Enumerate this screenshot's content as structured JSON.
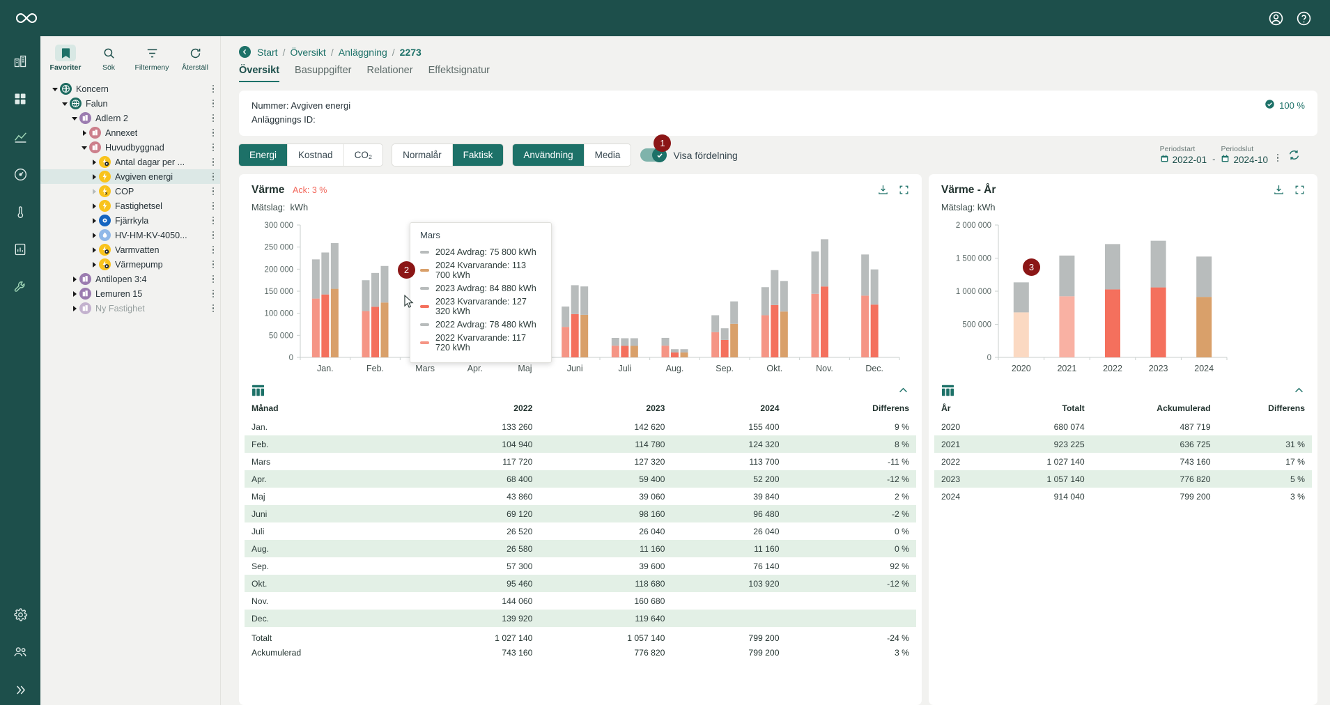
{
  "topbar": {
    "account_icon": "account-circle-icon",
    "help_icon": "help-circle-icon",
    "logo": "infinity-logo"
  },
  "rail": [
    {
      "name": "rail-item-buildings",
      "icon": "buildings-icon"
    },
    {
      "name": "rail-item-dashboard",
      "icon": "dashboard-grid-icon"
    },
    {
      "name": "rail-item-chart",
      "icon": "area-chart-icon"
    },
    {
      "name": "rail-item-gauge",
      "icon": "gauge-icon"
    },
    {
      "name": "rail-item-temperature",
      "icon": "thermometer-icon"
    },
    {
      "name": "rail-item-report",
      "icon": "report-icon"
    },
    {
      "name": "rail-item-tools",
      "icon": "wrench-icon"
    },
    {
      "name": "rail-item-settings",
      "icon": "gear-icon"
    },
    {
      "name": "rail-item-users",
      "icon": "people-icon"
    },
    {
      "name": "rail-item-expand",
      "icon": "chevron-double-right-icon"
    }
  ],
  "sidebar": {
    "tools": [
      {
        "label": "Favoriter",
        "icon": "bookmark-icon",
        "active": true
      },
      {
        "label": "Sök",
        "icon": "search-icon",
        "active": false
      },
      {
        "label": "Filtermeny",
        "icon": "filter-icon",
        "active": false
      },
      {
        "label": "Återställ",
        "icon": "refresh-icon",
        "active": false
      }
    ],
    "tree": [
      {
        "label": "Koncern",
        "depth": 0,
        "caret": "down",
        "icon": "globe-icon",
        "color": "#1d6b60",
        "selected": false,
        "muted": false
      },
      {
        "label": "Falun",
        "depth": 1,
        "caret": "down",
        "icon": "globe-icon",
        "color": "#1d6b60",
        "selected": false,
        "muted": false
      },
      {
        "label": "Adlern 2",
        "depth": 2,
        "caret": "down",
        "icon": "building-icon",
        "color": "#9b7cb0",
        "selected": false,
        "muted": false
      },
      {
        "label": "Annexet",
        "depth": 3,
        "caret": "right",
        "icon": "building-icon",
        "color": "#cc7f8b",
        "selected": false,
        "muted": false
      },
      {
        "label": "Huvudbyggnad",
        "depth": 3,
        "caret": "down",
        "icon": "building-icon",
        "color": "#cc7f8b",
        "selected": false,
        "muted": false
      },
      {
        "label": "Antal dagar per ...",
        "depth": 4,
        "caret": "right",
        "icon": "meter-icon",
        "color": "#f9c31c",
        "selected": false,
        "muted": false
      },
      {
        "label": "Avgiven energi",
        "depth": 4,
        "caret": "right",
        "icon": "bolt-icon",
        "color": "#f9c31c",
        "selected": true,
        "muted": false
      },
      {
        "label": "COP",
        "depth": 4,
        "caret": "right-muted",
        "icon": "formula-icon",
        "color": "#f9c31c",
        "selected": false,
        "muted": false
      },
      {
        "label": "Fastighetsel",
        "depth": 4,
        "caret": "right",
        "icon": "bolt-icon",
        "color": "#f9c31c",
        "selected": false,
        "muted": false
      },
      {
        "label": "Fjärrkyla",
        "depth": 4,
        "caret": "right",
        "icon": "snow-icon",
        "color": "#1565c0",
        "selected": false,
        "muted": false
      },
      {
        "label": "HV-HM-KV-4050...",
        "depth": 4,
        "caret": "right",
        "icon": "droplet-icon",
        "color": "#90b8e8",
        "selected": false,
        "muted": false
      },
      {
        "label": "Varmvatten",
        "depth": 4,
        "caret": "right",
        "icon": "meter-icon",
        "color": "#f9c31c",
        "selected": false,
        "muted": false
      },
      {
        "label": "Värmepump",
        "depth": 4,
        "caret": "right",
        "icon": "meter-icon",
        "color": "#f9c31c",
        "selected": false,
        "muted": false
      },
      {
        "label": "Antilopen 3:4",
        "depth": 2,
        "caret": "right",
        "icon": "building-icon",
        "color": "#9b7cb0",
        "selected": false,
        "muted": false
      },
      {
        "label": "Lemuren 15",
        "depth": 2,
        "caret": "right",
        "icon": "building-icon",
        "color": "#9b7cb0",
        "selected": false,
        "muted": false
      },
      {
        "label": "Ny Fastighet",
        "depth": 2,
        "caret": "right",
        "icon": "building-icon",
        "color": "#c3b2ce",
        "selected": false,
        "muted": true
      }
    ]
  },
  "breadcrumb": {
    "back_icon": "back-arrow-icon",
    "items": [
      "Start",
      "Översikt",
      "Anläggning"
    ],
    "current": "2273",
    "separator": "/"
  },
  "tabs": [
    {
      "label": "Översikt",
      "active": true
    },
    {
      "label": "Basuppgifter",
      "active": false
    },
    {
      "label": "Relationer",
      "active": false
    },
    {
      "label": "Effektsignatur",
      "active": false
    }
  ],
  "info": {
    "line1": "Nummer: Avgiven energi",
    "line2": "Anläggnings ID:",
    "percent": "100 %",
    "percent_icon": "check-circle-icon"
  },
  "controls": {
    "group1": [
      {
        "label": "Energi",
        "active": true
      },
      {
        "label": "Kostnad",
        "active": false
      },
      {
        "label": "CO₂",
        "active": false
      }
    ],
    "group2": [
      {
        "label": "Normalår",
        "active": false
      },
      {
        "label": "Faktisk",
        "active": true
      }
    ],
    "group3": [
      {
        "label": "Användning",
        "active": true
      },
      {
        "label": "Media",
        "active": false
      }
    ],
    "toggle": {
      "label": "Visa fördelning",
      "on": true,
      "badge": "1"
    },
    "period": {
      "start_label": "Periodstart",
      "end_label": "Periodslut",
      "start_value": "2022-01",
      "end_value": "2024-10",
      "dash": "-",
      "calendar_icon": "calendar-icon",
      "more_icon": "more-vertical-icon",
      "refresh_icon": "refresh-circular-icon"
    }
  },
  "left_panel": {
    "title": "Värme",
    "ack": "Ack: 3 %",
    "subtitle_label": "Mätslag:",
    "subtitle_value": "kWh",
    "download_icon": "download-icon",
    "expand_icon": "fullscreen-icon",
    "grid_icon": "table-grid-icon",
    "collapse_icon": "chevron-up-icon",
    "badge": "2",
    "tooltip": {
      "title": "Mars",
      "rows": [
        {
          "text": "2024 Avdrag: 75 800 kWh",
          "color": "#b8bcbc"
        },
        {
          "text": "2024 Kvarvarande: 113 700 kWh",
          "color": "#d9a06a"
        },
        {
          "text": "2023 Avdrag: 84 880 kWh",
          "color": "#b8bcbc"
        },
        {
          "text": "2023 Kvarvarande: 127 320 kWh",
          "color": "#f4705d"
        },
        {
          "text": "2022 Avdrag: 78 480 kWh",
          "color": "#b8bcbc"
        },
        {
          "text": "2022 Kvarvarande: 117 720 kWh",
          "color": "#f59585"
        }
      ]
    },
    "table": {
      "columns": [
        "Månad",
        "2022",
        "2023",
        "2024",
        "Differens"
      ],
      "rows": [
        [
          "Jan.",
          "133 260",
          "142 620",
          "155 400",
          "9 %"
        ],
        [
          "Feb.",
          "104 940",
          "114 780",
          "124 320",
          "8 %"
        ],
        [
          "Mars",
          "117 720",
          "127 320",
          "113 700",
          "-11 %"
        ],
        [
          "Apr.",
          "68 400",
          "59 400",
          "52 200",
          "-12 %"
        ],
        [
          "Maj",
          "43 860",
          "39 060",
          "39 840",
          "2 %"
        ],
        [
          "Juni",
          "69 120",
          "98 160",
          "96 480",
          "-2 %"
        ],
        [
          "Juli",
          "26 520",
          "26 040",
          "26 040",
          "0 %"
        ],
        [
          "Aug.",
          "26 580",
          "11 160",
          "11 160",
          "0 %"
        ],
        [
          "Sep.",
          "57 300",
          "39 600",
          "76 140",
          "92 %"
        ],
        [
          "Okt.",
          "95 460",
          "118 680",
          "103 920",
          "-12 %"
        ],
        [
          "Nov.",
          "144 060",
          "160 680",
          "",
          ""
        ],
        [
          "Dec.",
          "139 920",
          "119 640",
          "",
          ""
        ]
      ],
      "footer": [
        [
          "Totalt",
          "1 027 140",
          "1 057 140",
          "799 200",
          "-24 %"
        ],
        [
          "Ackumulerad",
          "743 160",
          "776 820",
          "799 200",
          "3 %"
        ]
      ]
    }
  },
  "right_panel": {
    "title": "Värme - År",
    "subtitle": "Mätslag: kWh",
    "download_icon": "download-icon",
    "expand_icon": "fullscreen-icon",
    "grid_icon": "table-grid-icon",
    "collapse_icon": "chevron-up-icon",
    "badge": "3",
    "table": {
      "columns": [
        "År",
        "Totalt",
        "Ackumulerad",
        "Differens"
      ],
      "rows": [
        [
          "2020",
          "680 074",
          "487 719",
          ""
        ],
        [
          "2021",
          "923 225",
          "636 725",
          "31 %"
        ],
        [
          "2022",
          "1 027 140",
          "743 160",
          "17 %"
        ],
        [
          "2023",
          "1 057 140",
          "776 820",
          "5 %"
        ],
        [
          "2024",
          "914 040",
          "799 200",
          "3 %"
        ]
      ]
    }
  },
  "colors": {
    "brand_dark": "#1d4f4b",
    "brand": "#1d7168",
    "accent_red": "#f2665a",
    "badge": "#8b1616",
    "grey_series": "#b8bcbc",
    "row_alt": "#e3f0e6"
  },
  "chart_data": [
    {
      "type": "bar",
      "stacked": true,
      "grouped": true,
      "title": "Värme",
      "subtitle": "Mätslag: kWh",
      "xlabel": "",
      "ylabel": "kWh",
      "ylim": [
        0,
        300000
      ],
      "yticks": [
        0,
        50000,
        100000,
        150000,
        200000,
        250000,
        300000
      ],
      "ytick_labels": [
        "0",
        "50 000",
        "100 000",
        "150 000",
        "200 000",
        "250 000",
        "300 000"
      ],
      "categories": [
        "Jan.",
        "Feb.",
        "Mars",
        "Apr.",
        "Maj",
        "Juni",
        "Juli",
        "Aug.",
        "Sep.",
        "Okt.",
        "Nov.",
        "Dec."
      ],
      "grid": false,
      "legend": "none",
      "series": [
        {
          "name": "2022 Kvarvarande",
          "color": "#f59585",
          "values": [
            133260,
            104940,
            117720,
            68400,
            43860,
            69120,
            26520,
            26580,
            57300,
            95460,
            144060,
            139920
          ]
        },
        {
          "name": "2022 Avdrag",
          "color": "#b8bcbc",
          "values": [
            88840,
            69960,
            78480,
            45600,
            29240,
            46080,
            17680,
            17720,
            38200,
            63640,
            96040,
            93280
          ]
        },
        {
          "name": "2023 Kvarvarande",
          "color": "#f4705d",
          "values": [
            142620,
            114780,
            127320,
            59400,
            39060,
            98160,
            26040,
            11160,
            39600,
            118680,
            160680,
            119640
          ]
        },
        {
          "name": "2023 Avdrag",
          "color": "#b8bcbc",
          "values": [
            95080,
            76520,
            84880,
            39600,
            26040,
            65440,
            17360,
            7440,
            26400,
            79120,
            107120,
            79760
          ]
        },
        {
          "name": "2024 Kvarvarande",
          "color": "#d9a06a",
          "values": [
            155400,
            124320,
            113700,
            52200,
            39840,
            96480,
            26040,
            11160,
            76140,
            103920,
            null,
            null
          ]
        },
        {
          "name": "2024 Avdrag",
          "color": "#b8bcbc",
          "values": [
            103600,
            82880,
            75800,
            34800,
            26560,
            64320,
            17360,
            7440,
            50760,
            69280,
            null,
            null
          ]
        }
      ]
    },
    {
      "type": "bar",
      "stacked": true,
      "title": "Värme - År",
      "subtitle": "Mätslag: kWh",
      "xlabel": "",
      "ylabel": "kWh",
      "ylim": [
        0,
        2000000
      ],
      "yticks": [
        0,
        500000,
        1000000,
        1500000,
        2000000
      ],
      "ytick_labels": [
        "0",
        "500 000",
        "1 000 000",
        "1 500 000",
        "2 000 000"
      ],
      "categories": [
        "2020",
        "2021",
        "2022",
        "2023",
        "2024"
      ],
      "grid": false,
      "legend": "none",
      "series": [
        {
          "name": "Kvarvarande",
          "colors": [
            "#fbd9c2",
            "#f9b1a3",
            "#f4705d",
            "#f4705d",
            "#d9a06a"
          ],
          "values": [
            680074,
            923225,
            1027140,
            1057140,
            914040
          ]
        },
        {
          "name": "Avdrag",
          "color": "#b8bcbc",
          "values": [
            453383,
            615483,
            684760,
            704760,
            609360
          ]
        }
      ]
    }
  ]
}
